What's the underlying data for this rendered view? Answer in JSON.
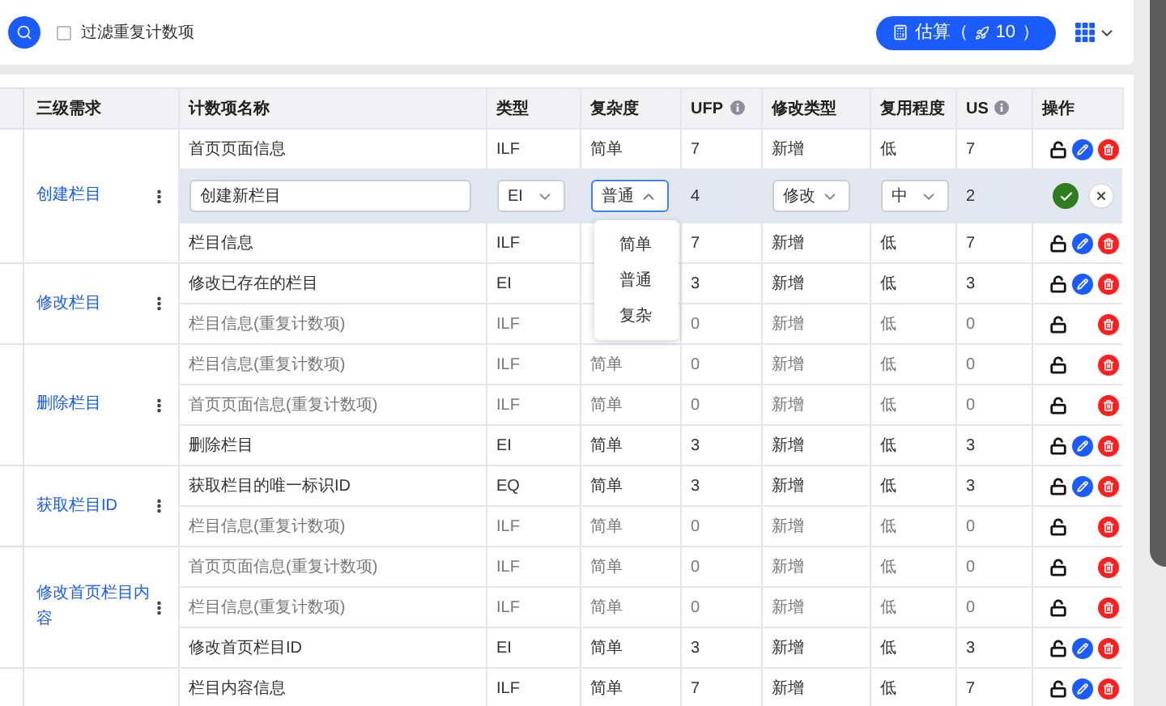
{
  "toolbar": {
    "filter": {
      "label": "过滤重复计数项",
      "checked": false
    },
    "estimate_button": "估算（",
    "estimate_count": "10",
    "estimate_close": "）"
  },
  "table": {
    "columns": [
      {
        "label": "三级需求"
      },
      {
        "label": "计数项名称"
      },
      {
        "label": "类型"
      },
      {
        "label": "复杂度"
      },
      {
        "label": "UFP",
        "info": true
      },
      {
        "label": "修改类型"
      },
      {
        "label": "复用程度"
      },
      {
        "label": "US",
        "info": true
      },
      {
        "label": "操作"
      }
    ],
    "groups": [
      {
        "name": "创建栏目",
        "rows": [
          {
            "kind": "normal",
            "name": "首页页面信息",
            "type": "ILF",
            "complexity": "简单",
            "ufp": "7",
            "change": "新增",
            "reuse": "低",
            "us": "7"
          },
          {
            "kind": "editing",
            "name": "创建新栏目",
            "type": "EI",
            "complexity": "普通",
            "ufp": "4",
            "change": "修改",
            "reuse": "中",
            "us": "2",
            "dropdown": {
              "open": true,
              "options": [
                "简单",
                "普通",
                "复杂"
              ]
            }
          },
          {
            "kind": "normal",
            "name": "栏目信息",
            "type": "ILF",
            "ufp": "7",
            "change": "新增",
            "reuse": "低",
            "us": "7"
          }
        ]
      },
      {
        "name": "修改栏目",
        "rows": [
          {
            "kind": "normal",
            "name": "修改已存在的栏目",
            "type": "EI",
            "ufp": "3",
            "change": "新增",
            "reuse": "低",
            "us": "3"
          },
          {
            "kind": "duplicate",
            "name": "栏目信息(重复计数项)",
            "type": "ILF",
            "ufp": "0",
            "change": "新增",
            "reuse": "低",
            "us": "0"
          }
        ]
      },
      {
        "name": "删除栏目",
        "rows": [
          {
            "kind": "duplicate",
            "name": "栏目信息(重复计数项)",
            "type": "ILF",
            "complexity": "简单",
            "ufp": "0",
            "change": "新增",
            "reuse": "低",
            "us": "0"
          },
          {
            "kind": "duplicate",
            "name": "首页页面信息(重复计数项)",
            "type": "ILF",
            "complexity": "简单",
            "ufp": "0",
            "change": "新增",
            "reuse": "低",
            "us": "0"
          },
          {
            "kind": "normal",
            "name": "删除栏目",
            "type": "EI",
            "complexity": "简单",
            "ufp": "3",
            "change": "新增",
            "reuse": "低",
            "us": "3"
          }
        ]
      },
      {
        "name": "获取栏目ID",
        "rows": [
          {
            "kind": "normal",
            "name": "获取栏目的唯一标识ID",
            "type": "EQ",
            "complexity": "简单",
            "ufp": "3",
            "change": "新增",
            "reuse": "低",
            "us": "3"
          },
          {
            "kind": "duplicate",
            "name": "栏目信息(重复计数项)",
            "type": "ILF",
            "complexity": "简单",
            "ufp": "0",
            "change": "新增",
            "reuse": "低",
            "us": "0"
          }
        ]
      },
      {
        "name": "修改首页栏目内容",
        "rows": [
          {
            "kind": "duplicate",
            "name": "首页页面信息(重复计数项)",
            "type": "ILF",
            "complexity": "简单",
            "ufp": "0",
            "change": "新增",
            "reuse": "低",
            "us": "0"
          },
          {
            "kind": "duplicate",
            "name": "栏目信息(重复计数项)",
            "type": "ILF",
            "complexity": "简单",
            "ufp": "0",
            "change": "新增",
            "reuse": "低",
            "us": "0"
          },
          {
            "kind": "normal",
            "name": "修改首页栏目ID",
            "type": "EI",
            "complexity": "简单",
            "ufp": "3",
            "change": "新增",
            "reuse": "低",
            "us": "3"
          }
        ]
      },
      {
        "rows": [
          {
            "kind": "normal",
            "name": "栏目内容信息",
            "type": "ILF",
            "complexity": "简单",
            "ufp": "7",
            "change": "新增",
            "reuse": "低",
            "us": "7"
          }
        ]
      }
    ]
  }
}
